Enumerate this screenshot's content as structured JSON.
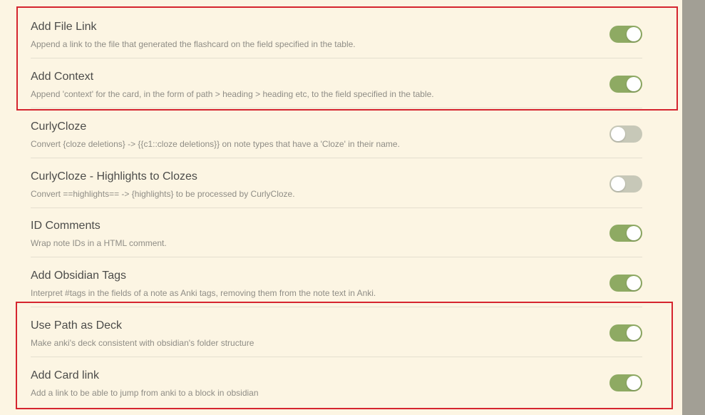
{
  "settings": [
    {
      "name": "Add File Link",
      "description": "Append a link to the file that generated the flashcard on the field specified in the table.",
      "enabled": true
    },
    {
      "name": "Add Context",
      "description": "Append 'context' for the card, in the form of path > heading > heading etc, to the field specified in the table.",
      "enabled": true
    },
    {
      "name": "CurlyCloze",
      "description": "Convert {cloze deletions} -> {{c1::cloze deletions}} on note types that have a 'Cloze' in their name.",
      "enabled": false
    },
    {
      "name": "CurlyCloze - Highlights to Clozes",
      "description": "Convert ==highlights== -> {highlights} to be processed by CurlyCloze.",
      "enabled": false
    },
    {
      "name": "ID Comments",
      "description": "Wrap note IDs in a HTML comment.",
      "enabled": true
    },
    {
      "name": "Add Obsidian Tags",
      "description": "Interpret #tags in the fields of a note as Anki tags, removing them from the note text in Anki.",
      "enabled": true
    },
    {
      "name": "Use Path as Deck",
      "description": "Make anki's deck consistent with obsidian's folder structure",
      "enabled": true
    },
    {
      "name": "Add Card link",
      "description": "Add a link to be able to jump from anki to a block in obsidian",
      "enabled": true
    }
  ],
  "colors": {
    "panel_background": "#fcf5e3",
    "toggle_on": "#8eaa63",
    "toggle_off": "#c7c8b8",
    "highlight_border": "#d5252f"
  }
}
